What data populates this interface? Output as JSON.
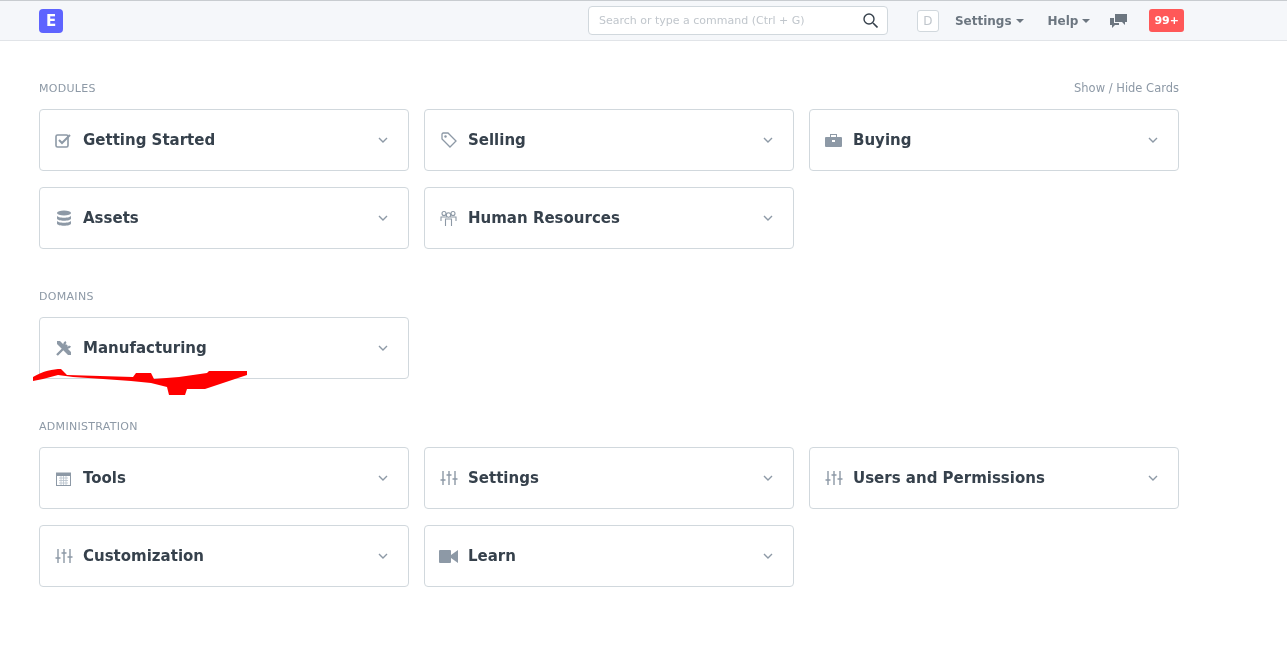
{
  "navbar": {
    "logo": "E",
    "search": {
      "placeholder": "Search or type a command (Ctrl + G)"
    },
    "avatar": "D",
    "menus": [
      "Settings",
      "Help"
    ],
    "notifications": "99+"
  },
  "show_hide": "Show / Hide Cards",
  "sections": [
    {
      "title": "MODULES",
      "cards": [
        {
          "label": "Getting Started",
          "kind": "checklist",
          "underlined": false
        },
        {
          "label": "Selling",
          "kind": "sales",
          "underlined": false
        },
        {
          "label": "Buying",
          "kind": "purchase",
          "underlined": false
        },
        {
          "label": "Assets",
          "kind": "storage",
          "underlined": false
        },
        {
          "label": "Human Resources",
          "kind": "staff",
          "underlined": false
        }
      ]
    },
    {
      "title": "DOMAINS",
      "cards": [
        {
          "label": "Manufacturing",
          "kind": "production",
          "underlined": true
        }
      ]
    },
    {
      "title": "ADMINISTRATION",
      "cards": [
        {
          "label": "Tools",
          "kind": "utility",
          "underlined": false
        },
        {
          "label": "Settings",
          "kind": "config",
          "underlined": false
        },
        {
          "label": "Users and Permissions",
          "kind": "config",
          "underlined": false
        },
        {
          "label": "Customization",
          "kind": "config",
          "underlined": false
        },
        {
          "label": "Learn",
          "kind": "media",
          "underlined": false
        }
      ]
    }
  ]
}
